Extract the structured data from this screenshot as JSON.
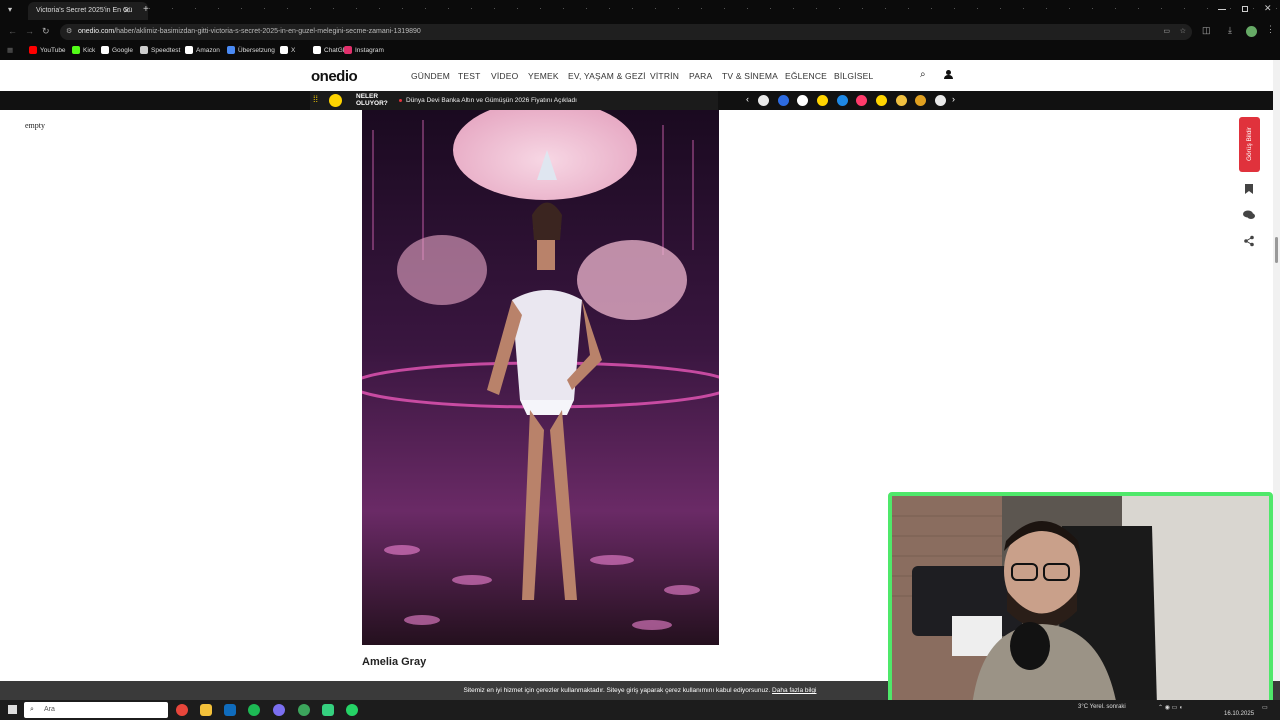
{
  "browser": {
    "tab_title": "Victoria's Secret 2025'in En Gü",
    "tab_close": "✕",
    "new_tab": "+",
    "url_host": "onedio.com",
    "url_path": "/haber/aklimiz-basimizdan-gitti-victoria-s-secret-2025-in-en-guzel-melegini-secme-zamani-1319890",
    "bookmarks": [
      {
        "label": "YouTube",
        "color": "#ff0000"
      },
      {
        "label": "Kick",
        "color": "#53fc18"
      },
      {
        "label": "Google",
        "color": "#ffffff"
      },
      {
        "label": "Speedtest",
        "color": "#cccccc"
      },
      {
        "label": "Amazon",
        "color": "#ffffff"
      },
      {
        "label": "Übersetzung",
        "color": "#4a8af4"
      },
      {
        "label": "X",
        "color": "#ffffff"
      },
      {
        "label": "ChatGPT",
        "color": "#ffffff"
      },
      {
        "label": "Instagram",
        "color": "#e1306c"
      }
    ]
  },
  "site": {
    "logo": "onedio",
    "nav": [
      "GÜNDEM",
      "TEST",
      "VİDEO",
      "YEMEK",
      "EV, YAŞAM & GEZİ",
      "VİTRİN",
      "PARA",
      "TV & SİNEMA",
      "EĞLENCE",
      "BİLGİSEL"
    ],
    "ticker_label_1": "NELER",
    "ticker_label_2": "OLUYOR?",
    "ticker_headline": "Dünya Devi Banka Altın ve Gümüşün 2026 Fiyatını Açıkladı",
    "feedback_label": "Görüş Bildir"
  },
  "page": {
    "empty_text": "empty",
    "caption": "Amelia Gray"
  },
  "cookie": {
    "text": "Sitemiz en iyi hizmet için çerezler kullanmaktadır. Siteye giriş yaparak çerez kullanımını kabul ediyorsunuz.",
    "link": "Daha fazla bilgi"
  },
  "taskbar": {
    "search_placeholder": "Ara",
    "weather": "3°C  Yerel. sonraki",
    "date": "16.10.2025"
  },
  "colors": {
    "accent_red": "#e0323c",
    "webcam_border": "#4fe86a"
  }
}
